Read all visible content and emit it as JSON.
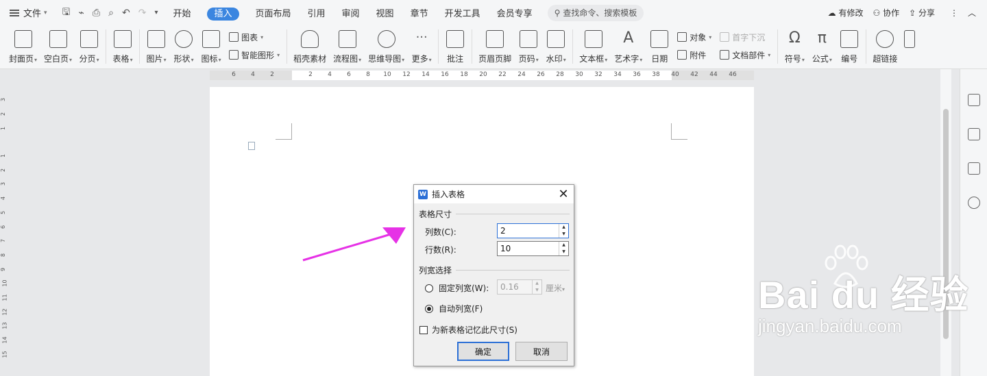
{
  "menubar": {
    "file_label": "文件",
    "tabs": [
      "开始",
      "插入",
      "页面布局",
      "引用",
      "审阅",
      "视图",
      "章节",
      "开发工具",
      "会员专享"
    ],
    "active_tab": "插入",
    "search_placeholder": "查找命令、搜索模板",
    "right": [
      "有修改",
      "协作",
      "分享"
    ]
  },
  "ribbon": {
    "big": [
      "封面页",
      "空白页",
      "分页",
      "表格",
      "图片",
      "形状",
      "图标"
    ],
    "stack1": [
      "图表",
      "智能图形"
    ],
    "big2": [
      "稻壳素材",
      "流程图",
      "思维导图",
      "更多",
      "批注",
      "页眉页脚",
      "页码",
      "水印",
      "文本框",
      "艺术字",
      "日期"
    ],
    "stack2": [
      "对象",
      "附件"
    ],
    "stack3": [
      "首字下沉",
      "文档部件"
    ],
    "big3": [
      "符号",
      "公式",
      "编号",
      "超链接"
    ]
  },
  "ruler": {
    "ticks": [
      "6",
      "4",
      "2",
      "2",
      "4",
      "6",
      "8",
      "10",
      "12",
      "14",
      "16",
      "18",
      "20",
      "22",
      "24",
      "26",
      "28",
      "30",
      "32",
      "34",
      "36",
      "38",
      "40",
      "42",
      "44",
      "46"
    ],
    "vticks": [
      "3",
      "2",
      "1",
      "1",
      "2",
      "3",
      "4",
      "5",
      "6",
      "7",
      "8",
      "9",
      "10",
      "11",
      "12",
      "13",
      "14",
      "15"
    ]
  },
  "dialog": {
    "title": "插入表格",
    "size_group": "表格尺寸",
    "cols_label": "列数(C):",
    "cols_value": "2",
    "rows_label": "行数(R):",
    "rows_value": "10",
    "width_group": "列宽选择",
    "fixed_label": "固定列宽(W):",
    "fixed_value": "0.16",
    "fixed_unit": "厘米",
    "auto_label": "自动列宽(F)",
    "remember_label": "为新表格记忆此尺寸(S)",
    "ok": "确定",
    "cancel": "取消"
  },
  "watermark": {
    "brand": "Bai du 经验",
    "url": "jingyan.baidu.com"
  },
  "colors": {
    "accent": "#3b86e0",
    "arrow": "#e632e6"
  }
}
